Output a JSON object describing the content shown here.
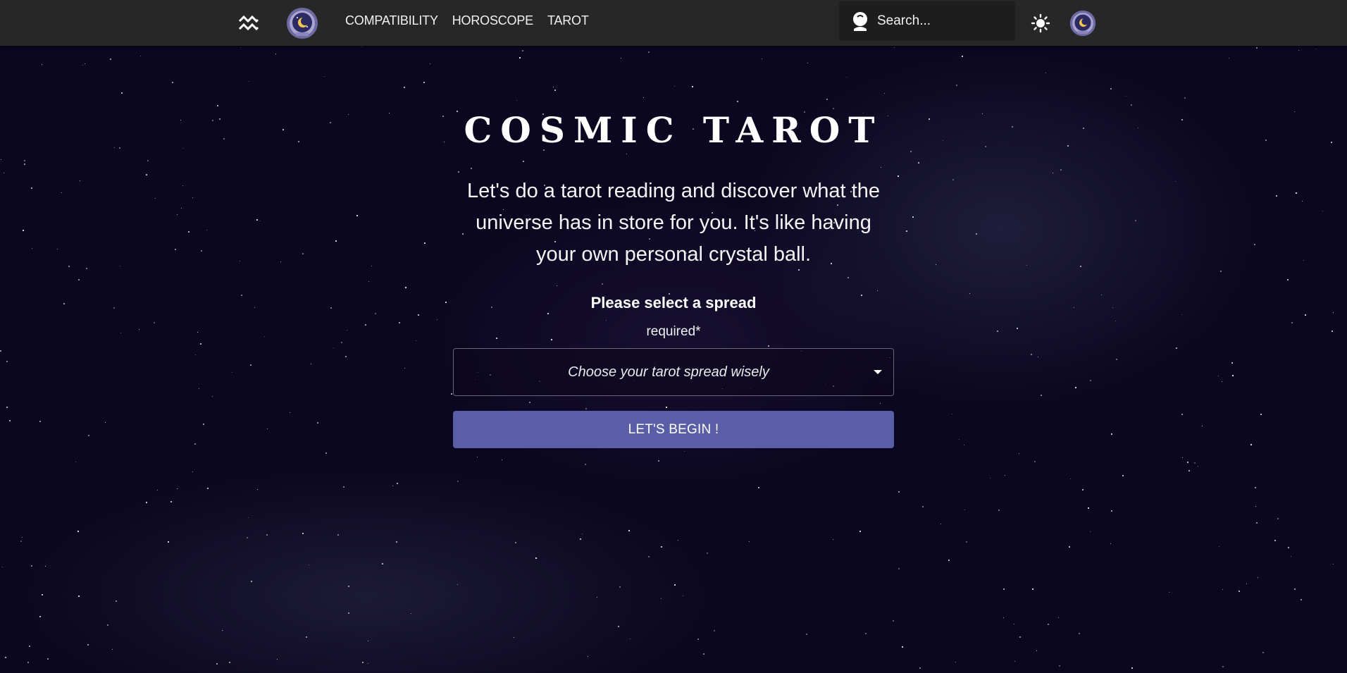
{
  "navbar": {
    "links": [
      "COMPATIBILITY",
      "HOROSCOPE",
      "TAROT"
    ],
    "search_placeholder": "Search...",
    "icons": {
      "zodiac": "aquarius-icon",
      "logo": "crystal-ball-moon-logo",
      "search": "crystal-ball-icon",
      "theme": "sun-icon",
      "profile": "crystal-ball-moon-logo"
    }
  },
  "hero": {
    "title": "COSMIC TAROT",
    "intro": "Let's do a tarot reading and discover what the universe has in store for you. It's like having your own personal crystal ball."
  },
  "spread_form": {
    "heading": "Please select a spread",
    "required_label": "required*",
    "select_placeholder": "Choose your tarot spread wisely",
    "submit_label": "LET'S BEGIN !"
  },
  "colors": {
    "navbar_bg": "#272727",
    "page_bg": "#0b0720",
    "button_bg": "#5a5ea6"
  }
}
